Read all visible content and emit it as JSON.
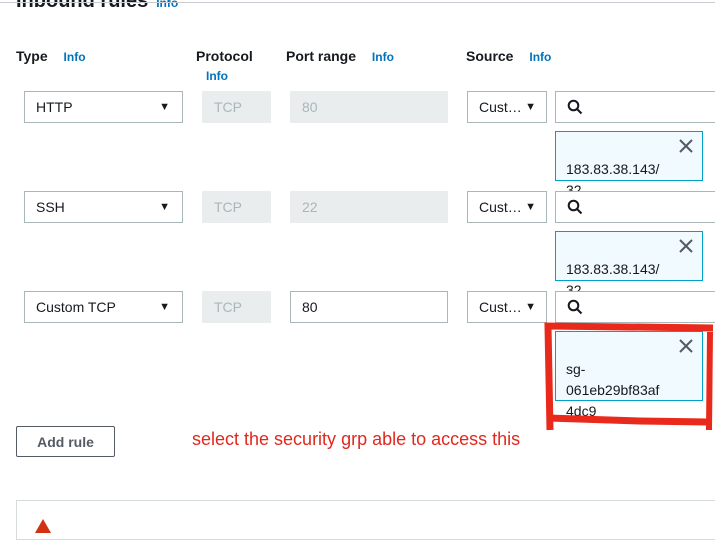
{
  "section": {
    "title": "Inbound rules",
    "info": "Info"
  },
  "headers": {
    "type": "Type",
    "type_info": "Info",
    "protocol": "Protocol",
    "protocol_info": "Info",
    "port_range": "Port range",
    "port_info": "Info",
    "source": "Source",
    "source_info": "Info"
  },
  "rules": [
    {
      "type": "HTTP",
      "protocol": "TCP",
      "port": "80",
      "source": "Cust…",
      "chip": "183.83.38.143/\n32"
    },
    {
      "type": "SSH",
      "protocol": "TCP",
      "port": "22",
      "source": "Cust…",
      "chip": "183.83.38.143/\n32"
    },
    {
      "type": "Custom TCP",
      "protocol": "TCP",
      "port": "80",
      "source": "Cust…",
      "chip": "sg-\n061eb29bf83af\n4dc9"
    }
  ],
  "add_rule_label": "Add rule",
  "annotation": "select the security grp able to access this",
  "colors": {
    "info_link": "#0073bb",
    "chip_border": "#00a1c9",
    "annotation": "#e0281e"
  },
  "icons": {
    "dropdown": "caret-down-icon",
    "search": "search-icon",
    "remove": "close-icon",
    "warning": "warning-icon"
  }
}
